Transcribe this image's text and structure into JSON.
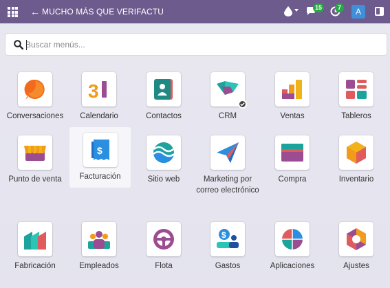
{
  "topbar": {
    "title": "MUCHO MÁS QUE VERIFACTU",
    "messages_count": "15",
    "activities_count": "7",
    "avatar_letter": "A",
    "bg_color": "#6d5b8d"
  },
  "search": {
    "placeholder": "Buscar menús...",
    "value": ""
  },
  "apps": [
    {
      "label": "Conversaciones",
      "icon": "discuss-icon"
    },
    {
      "label": "Calendario",
      "icon": "calendar-icon"
    },
    {
      "label": "Contactos",
      "icon": "contacts-icon"
    },
    {
      "label": "CRM",
      "icon": "crm-icon"
    },
    {
      "label": "Ventas",
      "icon": "sales-icon"
    },
    {
      "label": "Tableros",
      "icon": "dashboards-icon"
    },
    {
      "label": "Punto de venta",
      "icon": "point-of-sale-icon"
    },
    {
      "label": "Facturación",
      "icon": "invoicing-icon"
    },
    {
      "label": "Sitio web",
      "icon": "website-icon"
    },
    {
      "label": "Marketing por correo electrónico",
      "icon": "email-marketing-icon"
    },
    {
      "label": "Compra",
      "icon": "purchase-icon"
    },
    {
      "label": "Inventario",
      "icon": "inventory-icon"
    },
    {
      "label": "Fabricación",
      "icon": "manufacturing-icon"
    },
    {
      "label": "Empleados",
      "icon": "employees-icon"
    },
    {
      "label": "Flota",
      "icon": "fleet-icon"
    },
    {
      "label": "Gastos",
      "icon": "expenses-icon"
    },
    {
      "label": "Aplicaciones",
      "icon": "apps-icon"
    },
    {
      "label": "Ajustes",
      "icon": "settings-icon"
    }
  ]
}
